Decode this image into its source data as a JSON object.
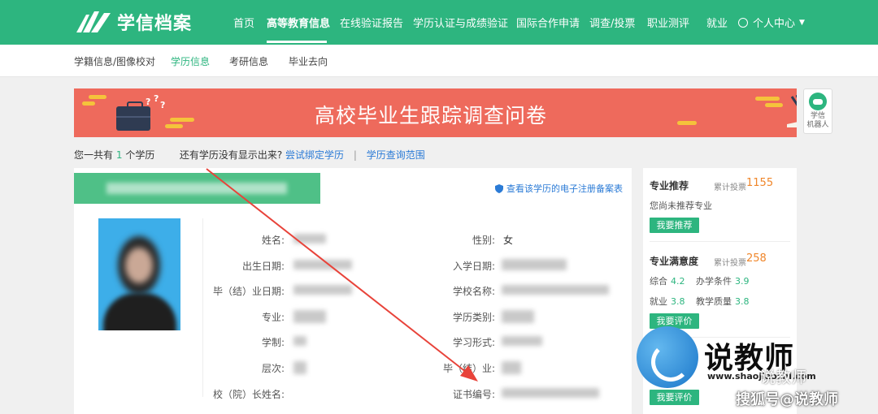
{
  "header": {
    "logo_text": "学信档案",
    "nav": [
      {
        "label": "首页"
      },
      {
        "label": "高等教育信息"
      },
      {
        "label": "在线验证报告"
      },
      {
        "label": "学历认证与成绩验证"
      },
      {
        "label": "国际合作申请"
      },
      {
        "label": "调查/投票"
      },
      {
        "label": "职业测评"
      },
      {
        "label": "就业"
      }
    ],
    "user_menu": "个人中心",
    "accent_color": "#2db57f"
  },
  "subnav": [
    {
      "label": "学籍信息/图像校对"
    },
    {
      "label": "学历信息"
    },
    {
      "label": "考研信息"
    },
    {
      "label": "毕业去向"
    }
  ],
  "banner": {
    "title": "高校毕业生跟踪调查问卷",
    "color": "#ee6a5c"
  },
  "robot": {
    "label_1": "学信",
    "label_2": "机器人"
  },
  "summary": {
    "prefix": "您一共有",
    "count": "1",
    "suffix": "个学历",
    "hint": "还有学历没有显示出来?",
    "bind_link": "尝试绑定学历",
    "separator": "|",
    "scope_link": "学历查询范围"
  },
  "record": {
    "record_link": "查看该学历的电子注册备案表",
    "left_fields": [
      {
        "label": "姓名:"
      },
      {
        "label": "出生日期:"
      },
      {
        "label": "毕（结）业日期:"
      },
      {
        "label": "专业:"
      },
      {
        "label": "学制:"
      },
      {
        "label": "层次:"
      },
      {
        "label": "校（院）长姓名:"
      }
    ],
    "right_fields": [
      {
        "label": "性别:",
        "value": "女"
      },
      {
        "label": "入学日期:",
        "value": ""
      },
      {
        "label": "学校名称:",
        "value": ""
      },
      {
        "label": "学历类别:",
        "value": ""
      },
      {
        "label": "学习形式:",
        "value": ""
      },
      {
        "label": "毕（结）业:",
        "value": ""
      },
      {
        "label": "证书编号:",
        "value": ""
      }
    ]
  },
  "sidebar": {
    "recommend": {
      "title": "专业推荐",
      "vote_label": "累计投票",
      "vote_count": "1155",
      "empty_text": "您尚未推荐专业",
      "button": "我要推荐"
    },
    "satisfaction": {
      "title": "专业满意度",
      "vote_label": "累计投票",
      "vote_count": "258",
      "scores": [
        {
          "label": "综合",
          "value": "4.2"
        },
        {
          "label": "办学条件",
          "value": "3.9"
        },
        {
          "label": "就业",
          "value": "3.8"
        },
        {
          "label": "教学质量",
          "value": "3.8"
        }
      ],
      "button": "我要评价"
    },
    "third": {
      "button": "我要评价"
    }
  },
  "watermark": {
    "title": "说教师",
    "url": "www.shaojiaoshi.com",
    "weibo": "说教师",
    "sohu": "搜狐号@说教师"
  }
}
